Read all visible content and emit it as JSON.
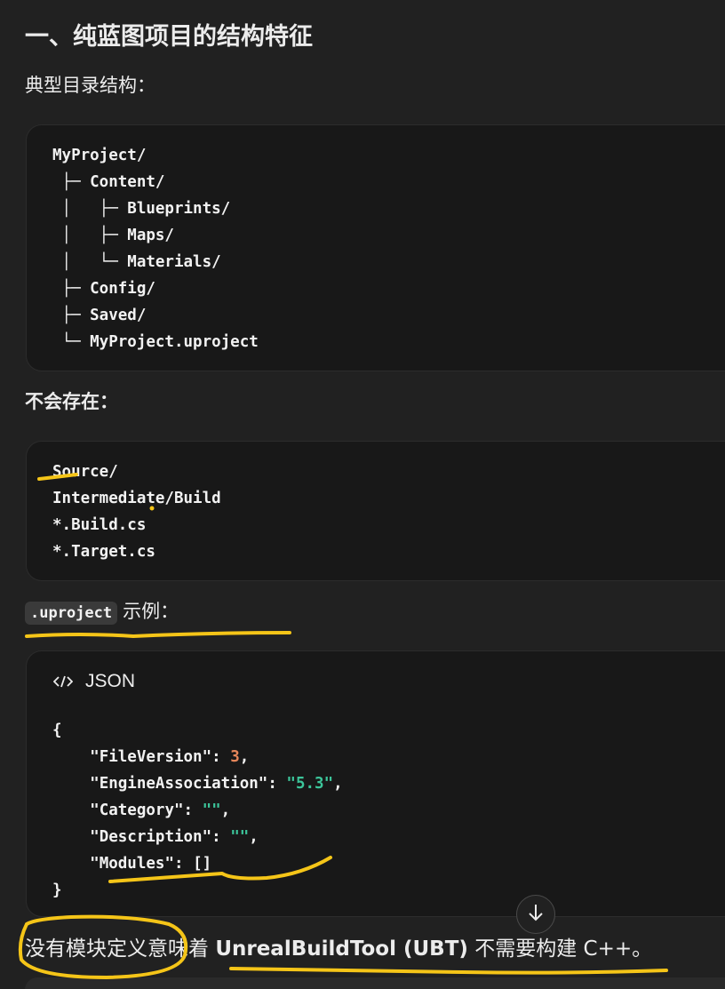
{
  "heading": "一、纯蓝图项目的结构特征",
  "typical_label": "典型目录结构：",
  "dir_tree": [
    "MyProject/",
    " ├─ Content/",
    " │   ├─ Blueprints/",
    " │   ├─ Maps/",
    " │   └─ Materials/",
    " ├─ Config/",
    " ├─ Saved/",
    " └─ MyProject.uproject"
  ],
  "absent_label": "不会存在：",
  "absent_items": [
    "Source/",
    "Intermediate/Build",
    "*.Build.cs",
    "*.Target.cs"
  ],
  "uproject_example": {
    "inline_code": ".uproject",
    "suffix": "示例："
  },
  "json_block": {
    "language_label": "JSON",
    "icon": "code-icon",
    "open_brace": "{",
    "close_brace": "}",
    "lines": [
      {
        "key": "\"FileVersion\"",
        "sep": ": ",
        "value": "3",
        "kind": "num",
        "tail": ","
      },
      {
        "key": "\"EngineAssociation\"",
        "sep": ": ",
        "value": "\"5.3\"",
        "kind": "str",
        "tail": ","
      },
      {
        "key": "\"Category\"",
        "sep": ": ",
        "value": "\"\"",
        "kind": "str",
        "tail": ","
      },
      {
        "key": "\"Description\"",
        "sep": ": ",
        "value": "\"\"",
        "kind": "str",
        "tail": ","
      },
      {
        "key": "\"Modules\"",
        "sep": ": ",
        "value": "[]",
        "kind": "plain",
        "tail": ""
      }
    ]
  },
  "final_sentence": {
    "prefix": "没有模块定义意味着 ",
    "bold": "UnrealBuildTool (UBT)",
    "suffix": " 不需要构建 C++。"
  },
  "scroll_button": {
    "icon": "arrow-down-icon"
  },
  "colors": {
    "background": "#212121",
    "code_bg": "#181818",
    "number": "#e5865a",
    "string": "#3cc59a",
    "highlight": "#f5c518"
  }
}
